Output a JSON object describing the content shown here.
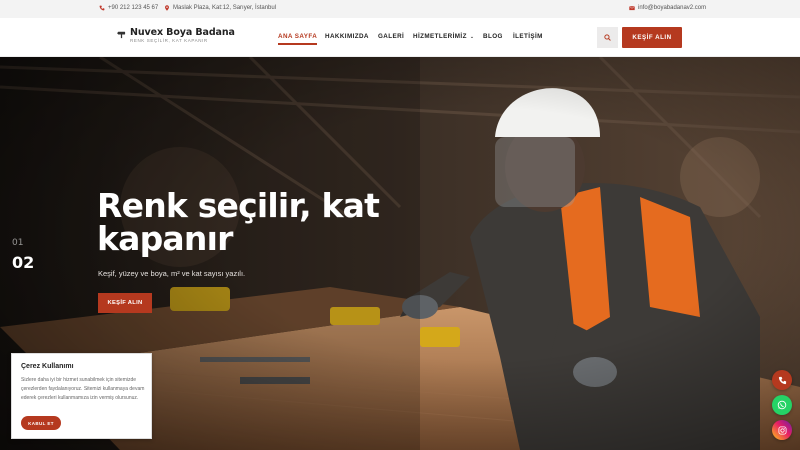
{
  "topbar": {
    "phone": "+90 212 123 45 67",
    "address": "Maslak Plaza, Kat:12, Sarıyer, İstanbul",
    "email": "info@boyabadanav2.com"
  },
  "header": {
    "logo_title": "Nuvex Boya Badana",
    "logo_tagline": "RENK SEÇİLİR, KAT KAPANIR",
    "nav": [
      {
        "label": "ANA SAYFA"
      },
      {
        "label": "HAKKIMIZDA"
      },
      {
        "label": "GALERİ"
      },
      {
        "label": "HİZMETLERİMİZ"
      },
      {
        "label": "BLOG"
      },
      {
        "label": "İLETİŞİM"
      }
    ],
    "cta_label": "KEŞİF ALIN"
  },
  "hero": {
    "slide_prev": "01",
    "slide_current": "02",
    "title_line1": "Renk seçilir, kat",
    "title_line2": "kapanır",
    "subtitle": "Keşif, yüzey ve boya, m² ve kat sayısı yazılı.",
    "button_label": "KEŞİF ALIN"
  },
  "cookie": {
    "title": "Çerez Kullanımı",
    "text": "Sizlere daha iyi bir hizmet sunabilmek için sitemizde çerezlerden faydalanıyoruz. Sitemizi kullanmaya devam ederek çerezleri kullanmamıza izin vermiş olursunuz.",
    "accept_label": "KABUL ET"
  },
  "colors": {
    "accent": "#b5391f",
    "whatsapp": "#25d366",
    "topbar_bg": "#f3f3f3"
  },
  "icons": {
    "phone": "phone-icon",
    "location": "location-pin-icon",
    "email": "envelope-icon",
    "search": "search-icon",
    "whatsapp": "whatsapp-icon",
    "instagram": "instagram-icon"
  }
}
